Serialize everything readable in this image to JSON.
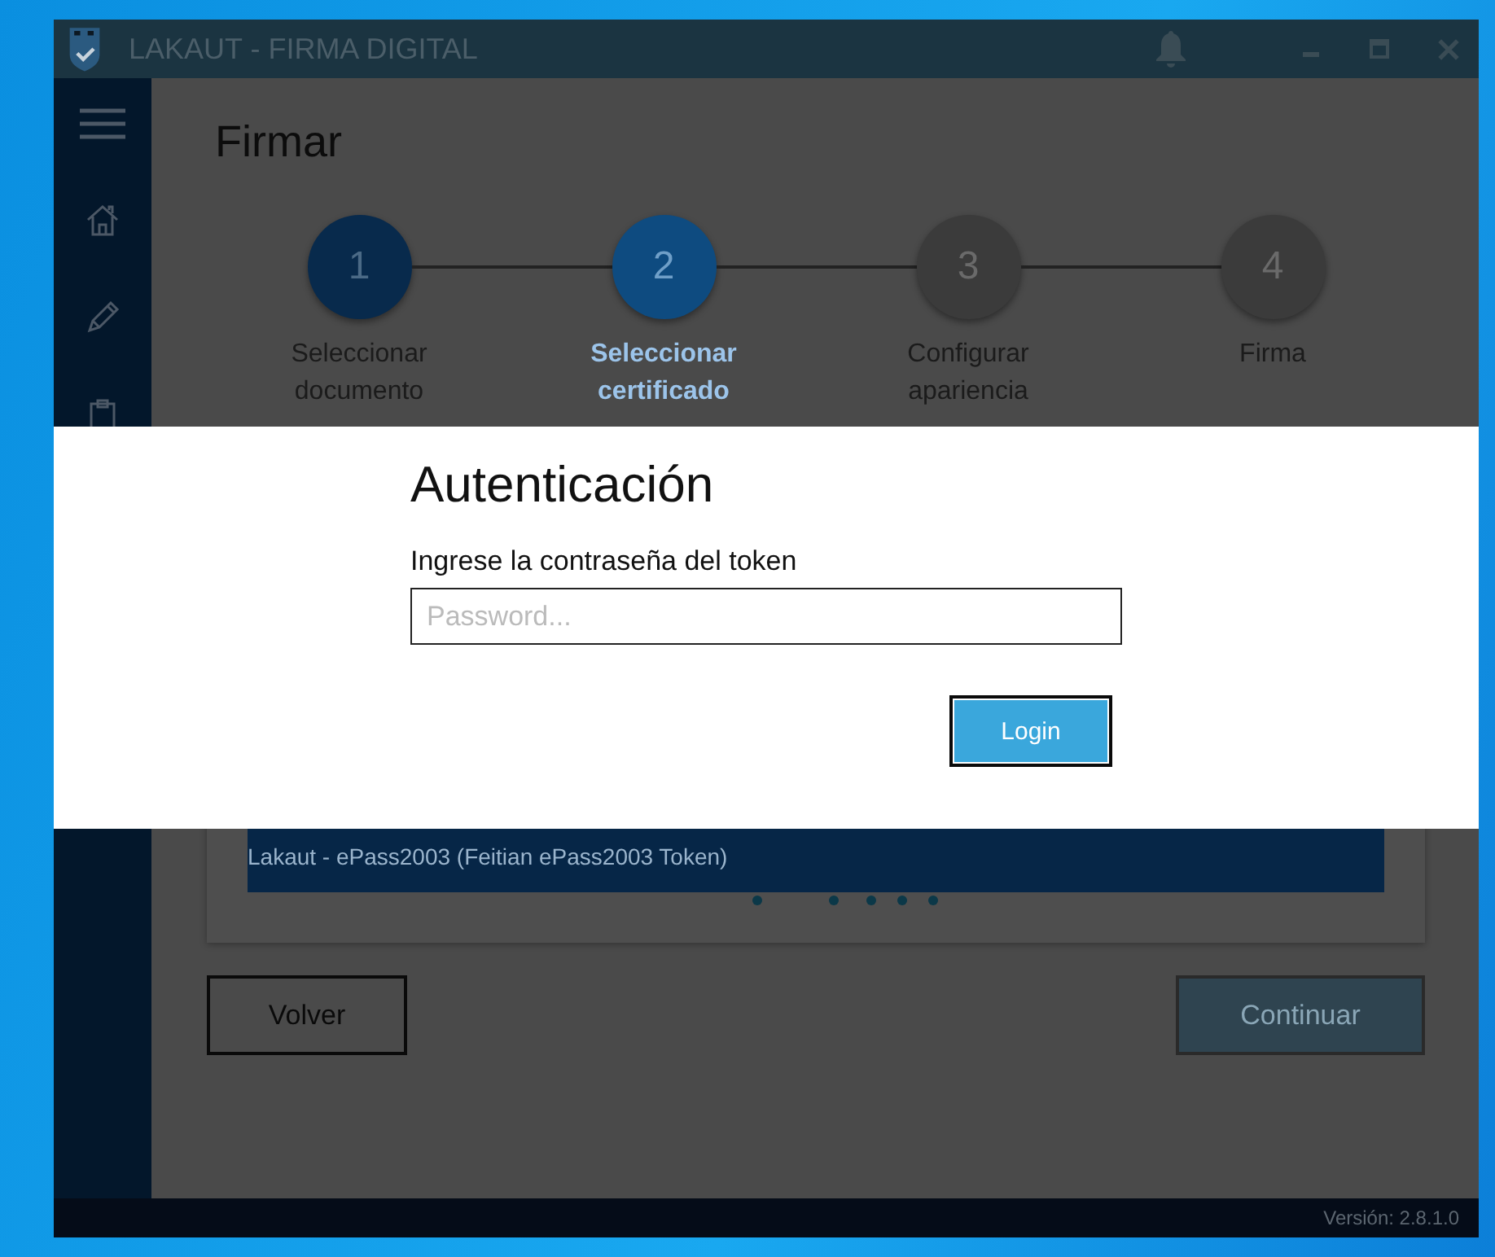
{
  "window": {
    "title": "LAKAUT - FIRMA DIGITAL"
  },
  "page": {
    "title": "Firmar"
  },
  "steps": [
    {
      "number": "1",
      "label": "Seleccionar documento",
      "completed": true,
      "selected": false
    },
    {
      "number": "2",
      "label": "Seleccionar certificado",
      "completed": false,
      "selected": true
    },
    {
      "number": "3",
      "label": "Configurar apariencia",
      "completed": false,
      "selected": false
    },
    {
      "number": "4",
      "label": "Firma",
      "completed": false,
      "selected": false
    }
  ],
  "certificates": [
    {
      "name": "Lakaut - ePass2003 (Feitian ePass2003 Token)",
      "selected": true
    }
  ],
  "buttons": [
    {
      "label": "Volver",
      "disabled": false
    },
    {
      "label": "Continuar",
      "disabled": true
    }
  ],
  "status_bar": {
    "version": "Versión: 2.8.1.0"
  },
  "dialog": {
    "title": "Autenticación",
    "label": "Ingrese la contraseña del token",
    "password": {
      "placeholder": "Password..."
    },
    "button": "Login"
  }
}
